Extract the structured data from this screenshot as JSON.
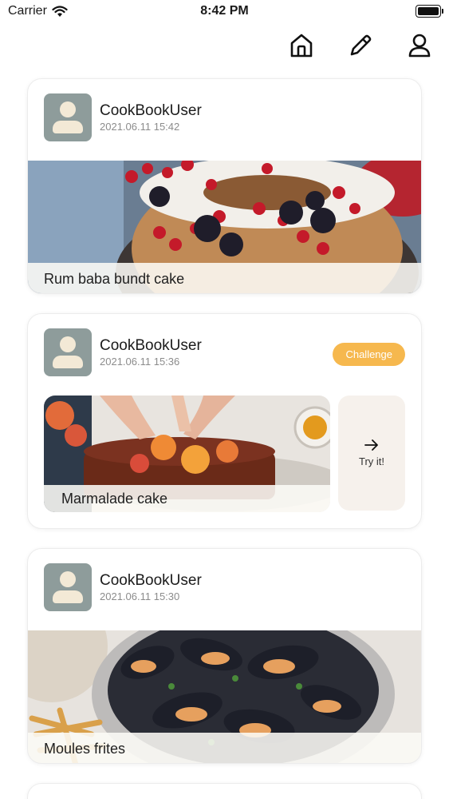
{
  "status_bar": {
    "carrier": "Carrier",
    "time": "8:42 PM"
  },
  "nav": {
    "icons": [
      "home-icon",
      "pencil-icon",
      "user-icon"
    ]
  },
  "posts": [
    {
      "user_name": "CookBookUser",
      "timestamp": "2021.06.11 15:42",
      "recipe_title": "Rum baba bundt cake"
    },
    {
      "user_name": "CookBookUser",
      "timestamp": "2021.06.11 15:36",
      "recipe_title": "Marmalade cake",
      "badge": "Challenge",
      "try_label": "Try it!"
    },
    {
      "user_name": "CookBookUser",
      "timestamp": "2021.06.11 15:30",
      "recipe_title": "Moules frites"
    }
  ],
  "colors": {
    "badge": "#f6b84e",
    "avatar_bg": "#8e9c9b",
    "avatar_fg": "#f3e9d6"
  }
}
